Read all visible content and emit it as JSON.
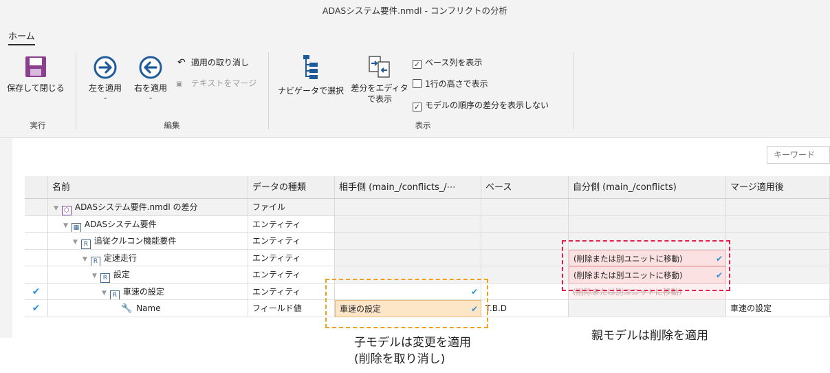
{
  "window": {
    "title": "ADASシステム要件.nmdl - コンフリクトの分析"
  },
  "ribbon": {
    "tab": "ホーム",
    "groups": {
      "execute": {
        "label": "実行",
        "save_close": "保存して閉じる"
      },
      "edit": {
        "label": "編集",
        "apply_left": "左を適用",
        "apply_right": "右を適用",
        "undo_apply": "適用の取り消し",
        "merge_text": "テキストをマージ"
      },
      "view": {
        "label": "表示",
        "navigator_select": "ナビゲータで選択",
        "diff_editor_line1": "差分をエディタ",
        "diff_editor_line2": "で表示",
        "show_base": "ベース列を表示",
        "one_line_height": "1行の高さで表示",
        "hide_order_diff": "モデルの順序の差分を表示しない",
        "show_base_checked": true,
        "one_line_height_checked": false,
        "hide_order_diff_checked": true
      }
    }
  },
  "search": {
    "placeholder": "キーワード"
  },
  "table": {
    "headers": [
      "名前",
      "データの種類",
      "相手側 (main_/conflicts_/⋯",
      "ベース",
      "自分側 (main_/conflicts)",
      "マージ適用後"
    ],
    "rows": [
      {
        "name": "ADASシステム要件.nmdl の差分",
        "type": "ファイル",
        "theirs": "",
        "base": "",
        "mine": "",
        "merged": "",
        "check": ""
      },
      {
        "name": "ADASシステム要件",
        "type": "エンティティ",
        "theirs": "",
        "base": "",
        "mine": "",
        "merged": "",
        "check": ""
      },
      {
        "name": "追従クルコン機能要件",
        "type": "エンティティ",
        "theirs": "",
        "base": "",
        "mine": "",
        "merged": "",
        "check": ""
      },
      {
        "name": "定速走行",
        "type": "エンティティ",
        "theirs": "",
        "base": "",
        "mine": "(削除または別ユニットに移動)",
        "merged": "",
        "check": ""
      },
      {
        "name": "設定",
        "type": "エンティティ",
        "theirs": "",
        "base": "",
        "mine": "(削除または別ユニットに移動)",
        "merged": "",
        "check": ""
      },
      {
        "name": "車速の設定",
        "type": "エンティティ",
        "theirs": "",
        "base": "",
        "mine": "(削除または別ユニットに移動)",
        "merged": "",
        "check": "✔"
      },
      {
        "name": "Name",
        "type": "フィールド値",
        "theirs": "車速の設定",
        "base": "T.B.D",
        "mine": "",
        "merged": "車速の設定",
        "check": "✔"
      }
    ]
  },
  "annotations": {
    "child_line1": "子モデルは変更を適用",
    "child_line2": "(削除を取り消し)",
    "parent": "親モデルは削除を適用"
  },
  "colors": {
    "red_dash": "#e0204c",
    "orange_dash": "#f0a01e",
    "check_blue": "#2b8fd6"
  }
}
